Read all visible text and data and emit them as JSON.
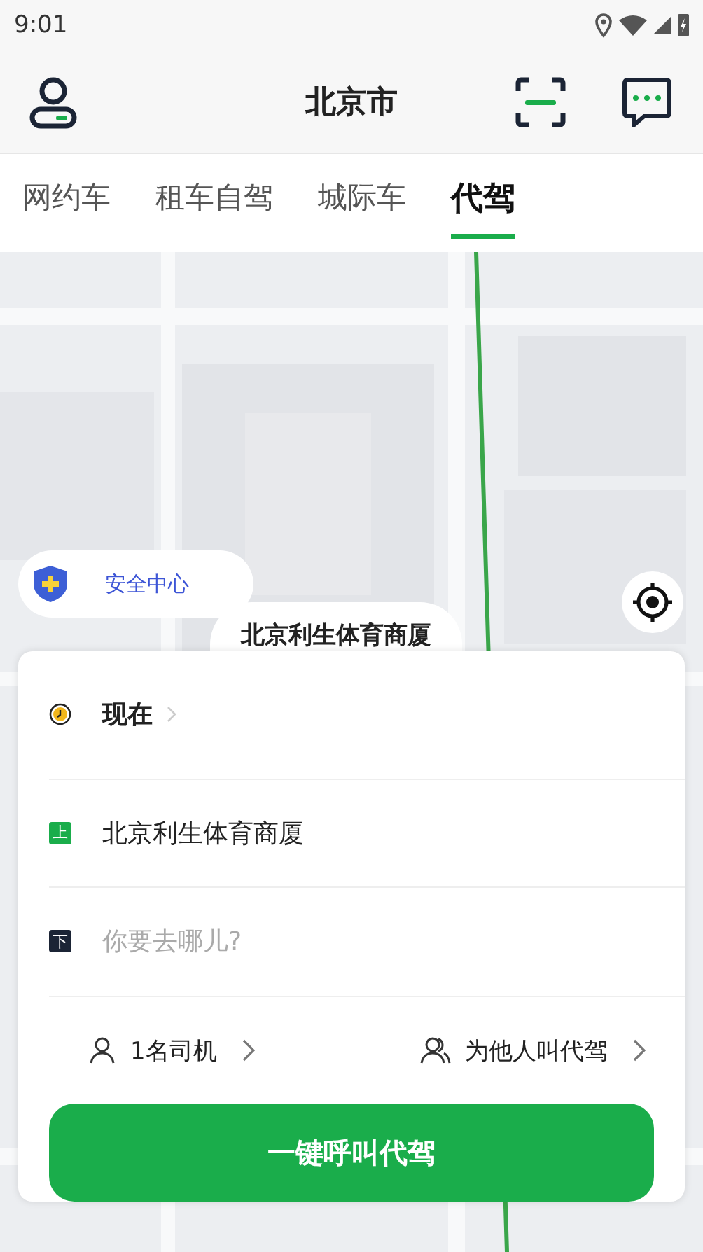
{
  "status_bar": {
    "time": "9:01"
  },
  "header": {
    "title": "北京市"
  },
  "tabs": [
    {
      "label": "网约车",
      "selected": false
    },
    {
      "label": "租车自驾",
      "selected": false
    },
    {
      "label": "城际车",
      "selected": false
    },
    {
      "label": "代驾",
      "selected": true
    }
  ],
  "map": {
    "safety_center": {
      "label": "安全中心"
    },
    "pin_label": "北京利生体育商厦"
  },
  "trip": {
    "time": {
      "label": "现在"
    },
    "pickup": {
      "badge": "上",
      "value": "北京利生体育商厦"
    },
    "dropoff": {
      "badge": "下",
      "placeholder": "你要去哪儿?"
    }
  },
  "options": [
    {
      "kind": "driver",
      "label": "1名司机"
    },
    {
      "kind": "others",
      "label": "为他人叫代驾"
    }
  ],
  "call_button": {
    "label": "一键呼叫代驾"
  }
}
